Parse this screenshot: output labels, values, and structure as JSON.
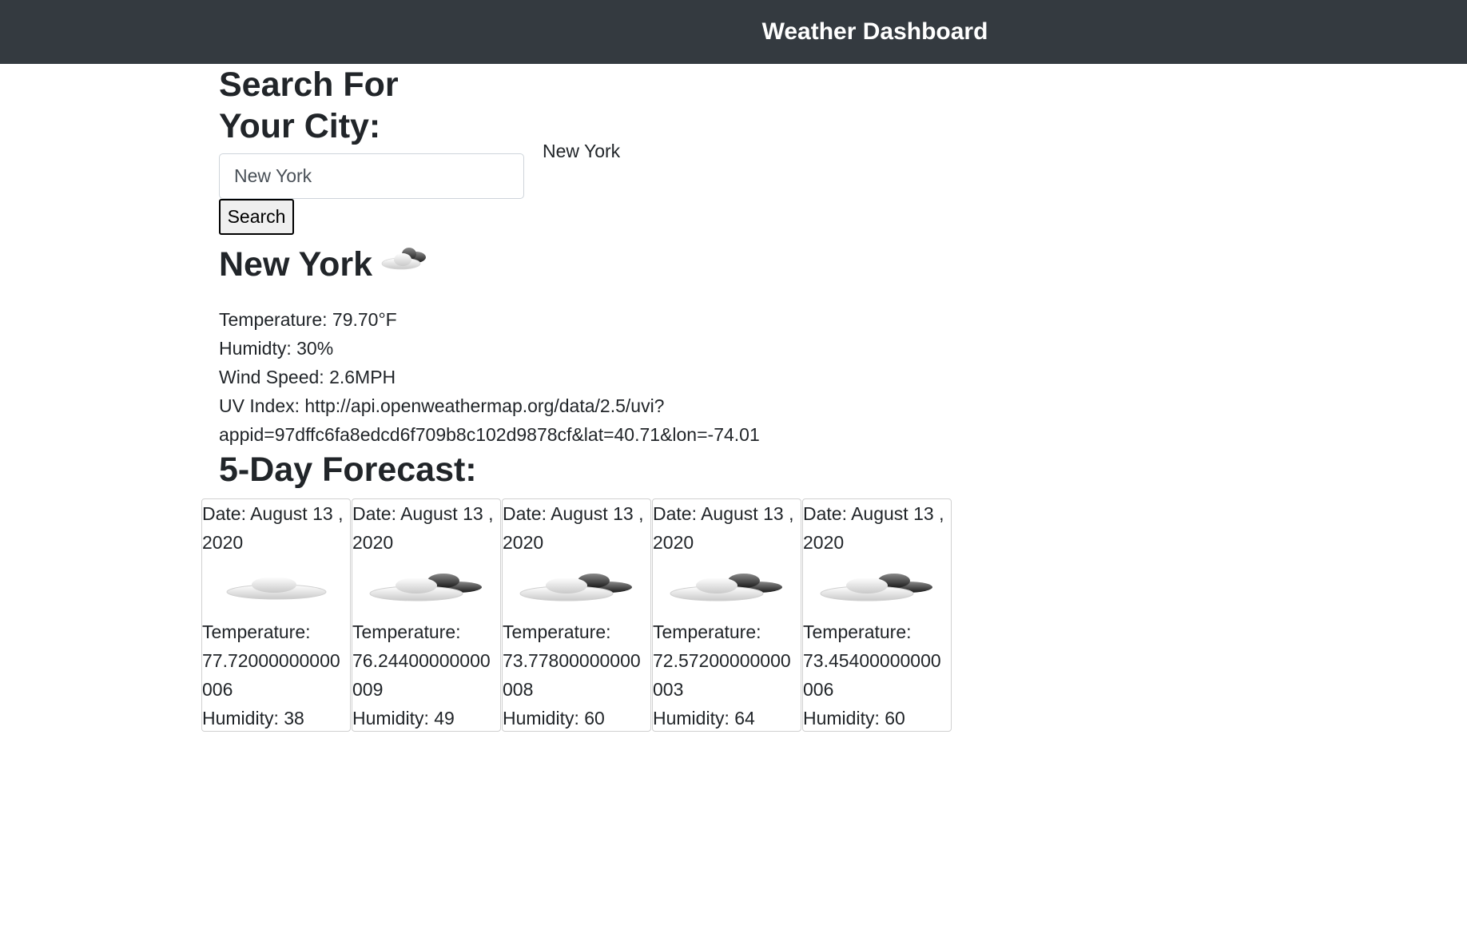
{
  "navbar": {
    "title": "Weather Dashboard"
  },
  "search": {
    "heading": "Search For Your City:",
    "input_value": "New York",
    "button_label": "Search",
    "saved_cities": [
      "New York"
    ]
  },
  "current": {
    "city": "New York",
    "icon": "partly-cloudy-icon",
    "temperature_line": "Temperature: 79.70°F",
    "humidity_line": "Humidty: 30%",
    "wind_line": "Wind Speed: 2.6MPH",
    "uv_line_1": "UV Index: http://api.openweathermap.org/data/2.5/uvi?",
    "uv_line_2": "appid=97dffc6fa8edcd6f709b8c102d9878cf&lat=40.71&lon=-74.01"
  },
  "forecast": {
    "heading": "5-Day Forecast:",
    "temperature_label": "Temperature:",
    "days": [
      {
        "date": "Date: August 13 , 2020",
        "icon": "cloud-icon",
        "temperature": "77.72000000000006",
        "humidity": "Humidity: 38"
      },
      {
        "date": "Date: August 13 , 2020",
        "icon": "broken-clouds-icon",
        "temperature": "76.24400000000009",
        "humidity": "Humidity: 49"
      },
      {
        "date": "Date: August 13 , 2020",
        "icon": "broken-clouds-icon",
        "temperature": "73.77800000000008",
        "humidity": "Humidity: 60"
      },
      {
        "date": "Date: August 13 , 2020",
        "icon": "broken-clouds-icon",
        "temperature": "72.57200000000003",
        "humidity": "Humidity: 64"
      },
      {
        "date": "Date: August 13 , 2020",
        "icon": "broken-clouds-icon",
        "temperature": "73.45400000000006",
        "humidity": "Humidity: 60"
      }
    ]
  }
}
